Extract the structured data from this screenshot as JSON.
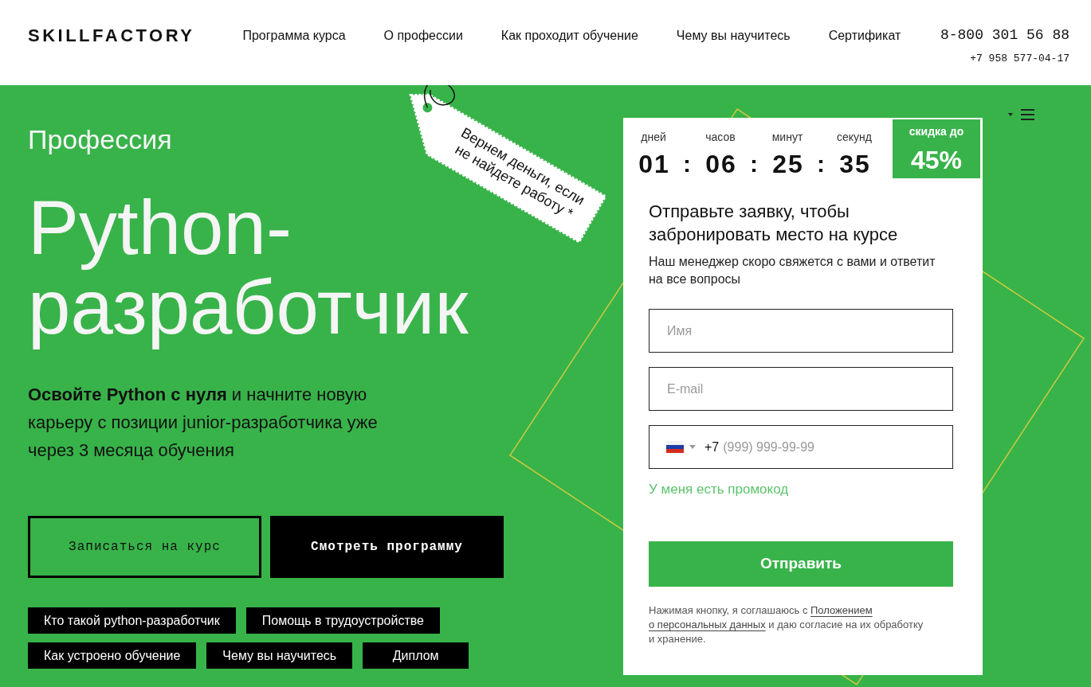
{
  "header": {
    "logo": "SKILLFACTORY",
    "nav": [
      "Программа курса",
      "О профессии",
      "Как проходит обучение",
      "Чему вы научитесь",
      "Сертификат"
    ],
    "phones": [
      "8-800 301 56 88",
      "+7 958 577-04-17"
    ]
  },
  "hero": {
    "eyebrow": "Профессия",
    "title_lines": [
      "Python-",
      "разработчик"
    ],
    "lead": "**Освойте Python с нуля** и начните новую карьеру с позиции junior-разработчика уже через 3 месяца обучения",
    "buttons": [
      {
        "kind": "outline",
        "label": "Записаться на курс"
      },
      {
        "kind": "filled",
        "label": "Смотреть программу"
      }
    ],
    "chips": [
      "Кто такой python-разработчик",
      "Помощь в трудоустройстве",
      "Как устроено обучение",
      "Чему вы научитесь",
      "Диплом"
    ],
    "guarantee_tag": "Вернем деньги, если не найдете работу *"
  },
  "form": {
    "timer": [
      {
        "label": "дней",
        "value": "01"
      },
      {
        "separator": ":",
        "label": "часов",
        "value": "06"
      },
      {
        "separator": ":",
        "label": "минут",
        "value": "25"
      },
      {
        "separator": ":",
        "label": "секунд",
        "value": "35"
      }
    ],
    "discount": {
      "label": "скидка до",
      "value": "45%"
    },
    "title": "Отправьте заявку, чтобы забронировать место на курсе",
    "subtitle": "Наш менеджер скоро свяжется с вами и ответит на все вопросы",
    "fields": [
      {
        "kind": "text",
        "placeholder": "Имя"
      },
      {
        "kind": "text",
        "placeholder": "E-mail"
      },
      {
        "kind": "phone",
        "prefix": "+7",
        "placeholder": "(999) 999-99-99"
      }
    ],
    "promo_link": "У меня есть промокод",
    "submit": "Отправить",
    "consent": [
      {
        "kind": "text",
        "text": "Нажимая кнопку, я соглашаюсь с"
      },
      {
        "kind": "link",
        "text": "Положением"
      },
      {
        "kind": "link",
        "text": "о персональных данных"
      },
      {
        "kind": "text",
        "text": "и даю согласие на их обработку и хранение."
      }
    ]
  }
}
